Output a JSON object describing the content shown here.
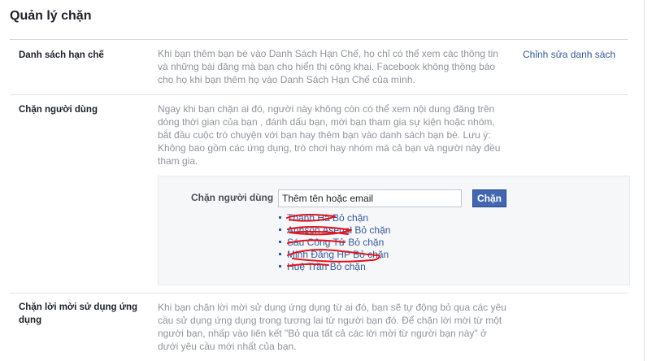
{
  "page_title": "Quản lý chặn",
  "restricted": {
    "label": "Danh sách hạn chế",
    "description": "Khi bạn thêm bạn bè vào Danh Sách Hạn Chế, họ chỉ có thể xem các thông tin và những bài đăng mà bạn cho hiển thị công khai. Facebook không thông báo cho họ khi bạn thêm họ vào Danh Sách Hạn Chế của mình.",
    "edit_link": "Chỉnh sửa danh sách"
  },
  "block_users": {
    "label": "Chặn người dùng",
    "description": "Ngay khi bạn chặn ai đó, người này không còn có thể xem nội dung đăng trên dòng thời gian của bạn , đánh dấu bạn, mời bạn tham gia sự kiện hoặc nhóm, bắt đầu cuộc trò chuyện với bạn hay thêm bạn vào danh sách bạn bè. Lưu ý: Không bao gồm các ứng dụng, trò chơi hay nhóm mà cả bạn và người này đều tham gia.",
    "form_label": "Chặn người dùng",
    "input_placeholder": "Thêm tên hoặc email",
    "button_label": "Chặn",
    "unblock_label": "Bỏ chặn",
    "blocked": [
      {
        "name": "Thanh Hà"
      },
      {
        "name": "Anhson Asenal"
      },
      {
        "name": "Sáu Công Tử"
      },
      {
        "name": "Minh Đăng HP"
      },
      {
        "name": "Huệ Trần"
      }
    ]
  },
  "app_invites": {
    "label": "Chặn lời mời sử dụng ứng dụng",
    "description": "Khi bạn chặn lời mời sử dụng ứng dụng từ ai đó, bạn sẽ tự động bỏ qua các yêu cầu sử dụng ứng dụng trong tương lai từ người bạn đó. Để chặn lời mời từ một người bạn, nhấp vào liên kết \"Bỏ qua tất cả các lời mời từ người bạn này\" ở dưới yêu cầu mới nhất của bạn."
  },
  "colors": {
    "link": "#365899",
    "button": "#4267b2",
    "scribble": "#e0141d"
  }
}
